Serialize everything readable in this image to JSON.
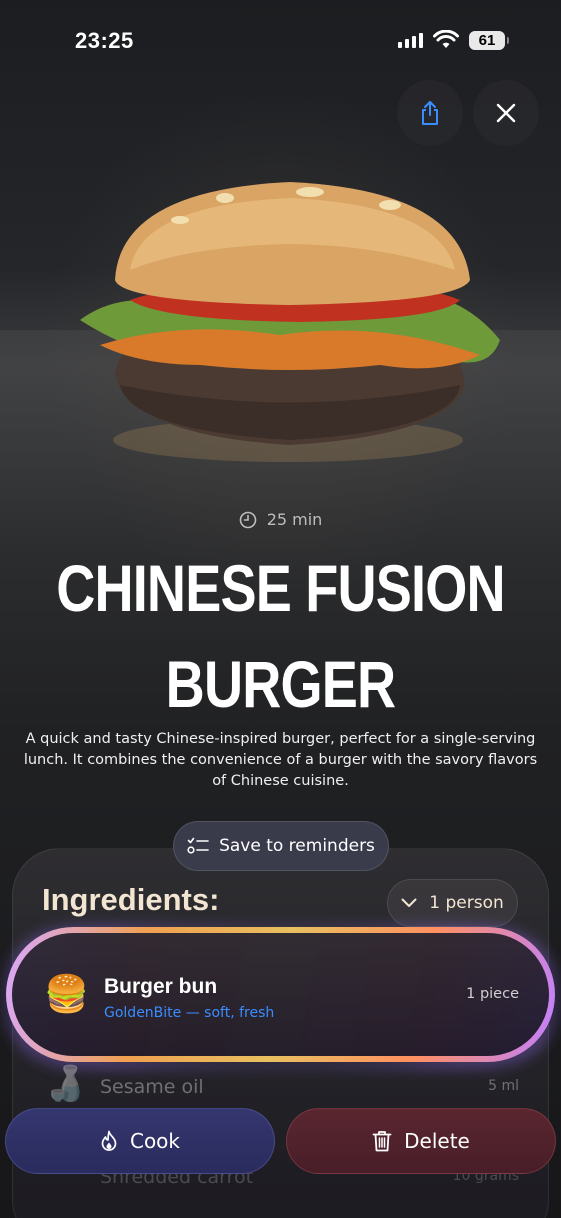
{
  "status_bar": {
    "time": "23:25",
    "battery": "61"
  },
  "recipe": {
    "duration": "25 min",
    "title_line1": "CHINESE FUSION",
    "title_line2": "BURGER",
    "description": "A quick and tasty Chinese-inspired burger, perfect for a single-serving lunch. It combines the convenience of a burger with the savory flavors of Chinese cuisine."
  },
  "actions": {
    "save_reminders": "Save to reminders",
    "cook": "Cook",
    "delete": "Delete"
  },
  "ingredients": {
    "heading": "Ingredients:",
    "servings": "1 person",
    "items": [
      {
        "emoji": "🍔",
        "name": "Burger bun",
        "detail": "GoldenBite — soft, fresh",
        "quantity": "1 piece"
      },
      {
        "emoji": "🍶",
        "name": "Sesame oil",
        "quantity": "5 ml"
      },
      {
        "name": "Shredded carrot",
        "quantity": "10 grams"
      }
    ]
  },
  "icons": {
    "share": "share-icon",
    "close": "close-icon",
    "clock": "clock-icon",
    "checklist": "checklist-icon",
    "chevron": "chevron-down-icon",
    "flame": "flame-icon",
    "trash": "trash-icon"
  }
}
